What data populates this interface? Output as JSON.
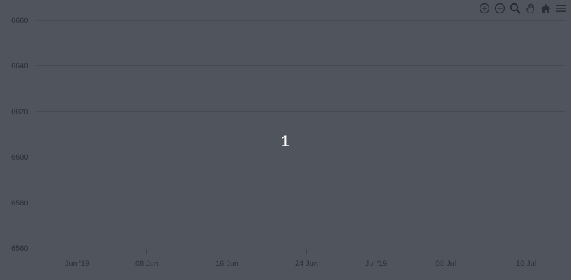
{
  "center_label": "1",
  "toolbar": {
    "icons": [
      "zoom-in-icon",
      "zoom-out-icon",
      "selection-zoom-icon",
      "pan-icon",
      "home-icon",
      "menu-icon"
    ]
  },
  "colors": {
    "background": "#50545d",
    "grid": "#454952",
    "axis": "#3c4048",
    "tick_text": "#2d3038",
    "icon": "#2b2e35",
    "icon_active": "#1f2a36",
    "center_text": "#ffffff"
  },
  "chart_data": {
    "type": "line",
    "x_type": "datetime",
    "xlim": [
      "2019-05-28",
      "2019-07-20"
    ],
    "ylim": [
      6560,
      6660
    ],
    "xticks": [
      {
        "date": "2019-06-01",
        "label": "Jun '19"
      },
      {
        "date": "2019-06-08",
        "label": "08 Jun"
      },
      {
        "date": "2019-06-16",
        "label": "16 Jun"
      },
      {
        "date": "2019-06-24",
        "label": "24 Jun"
      },
      {
        "date": "2019-07-01",
        "label": "Jul '19"
      },
      {
        "date": "2019-07-08",
        "label": "08 Jul"
      },
      {
        "date": "2019-07-16",
        "label": "16 Jul"
      }
    ],
    "yticks": [
      6560,
      6580,
      6600,
      6620,
      6640,
      6660
    ],
    "grid": true,
    "series": []
  }
}
